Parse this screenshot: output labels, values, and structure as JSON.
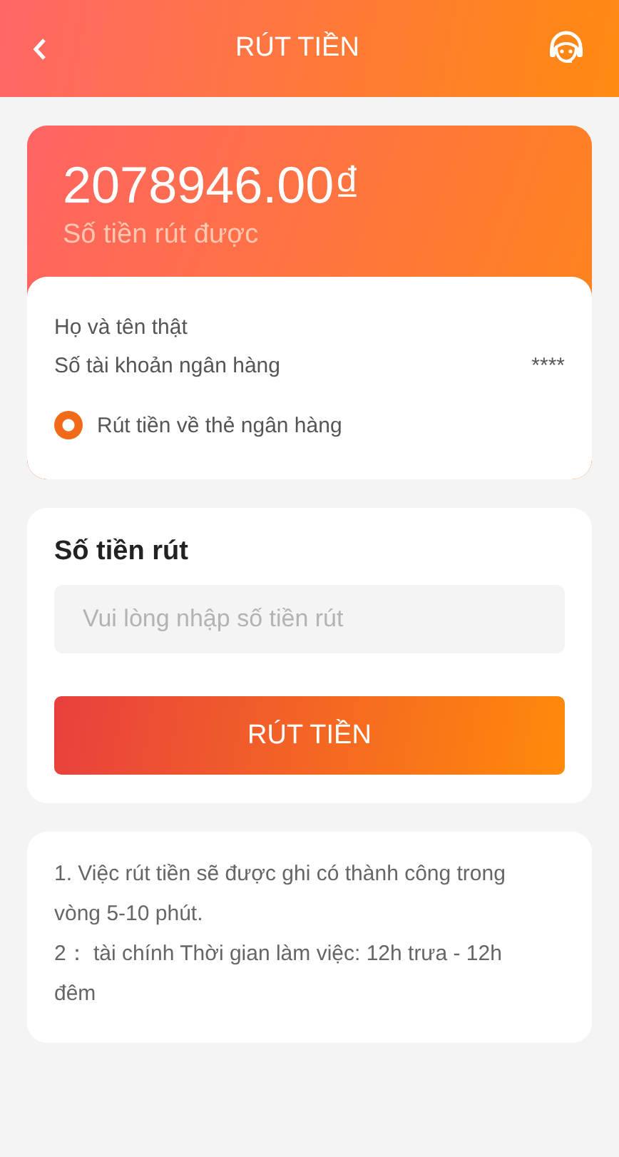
{
  "header": {
    "title": "RÚT TIỀN"
  },
  "balance": {
    "amount": "2078946.00₫",
    "label": "Số tiền rút được"
  },
  "account": {
    "rows": [
      {
        "label": "Họ và tên thật"
      },
      {
        "label": "Số tài khoản ngân hàng",
        "value": "****"
      }
    ],
    "options": [
      {
        "label": "Rút tiền về thẻ ngân hàng",
        "selected": true
      }
    ]
  },
  "withdraw": {
    "title": "Số tiền rút",
    "placeholder": "Vui lòng nhập số tiền rút",
    "button": "RÚT TIỀN"
  },
  "notes": [
    "1. Việc rút tiền sẽ được ghi có thành công trong vòng 5-10 phút.",
    "2：  tài chính Thời gian làm việc: 12h trưa - 12h đêm"
  ]
}
